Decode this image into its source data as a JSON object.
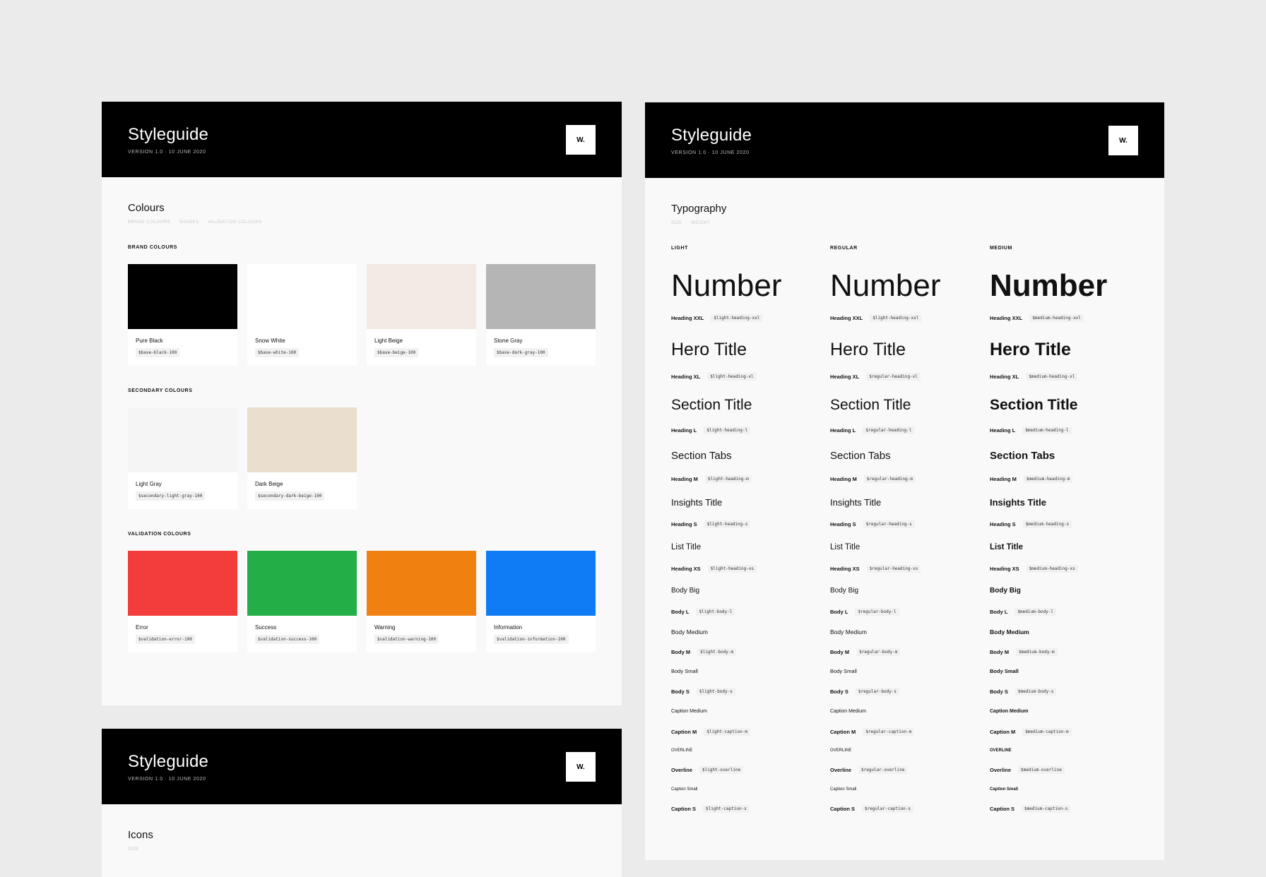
{
  "header": {
    "title": "Styleguide",
    "version": "VERSION 1.0 · 10 JUNE 2020",
    "logo": "W."
  },
  "colours": {
    "title": "Colours",
    "tabs": [
      "BRAND COLOURS",
      "SHADES",
      "VALIDATION COLOURS"
    ],
    "groups": [
      {
        "label": "BRAND COLOURS",
        "swatches": [
          {
            "name": "Pure Black",
            "token": "$base-black-100",
            "color": "#000000"
          },
          {
            "name": "Snow White",
            "token": "$base-white-100",
            "color": "#ffffff"
          },
          {
            "name": "Light Beige",
            "token": "$base-beige-100",
            "color": "#f2ebe3"
          },
          {
            "name": "Stone Gray",
            "token": "$base-dark-gray-100",
            "color": "#b5b5b5"
          }
        ]
      },
      {
        "label": "SECONDARY COLOURS",
        "swatches": [
          {
            "name": "Light Gray",
            "token": "$secondary-light-gray-100",
            "color": "#f5f5f5"
          },
          {
            "name": "Dark Beige",
            "token": "$secondary-dark-beige-100",
            "color": "#eadece"
          }
        ]
      },
      {
        "label": "VALIDATION COLOURS",
        "swatches": [
          {
            "name": "Error",
            "token": "$validation-error-100",
            "color": "#f23d3a"
          },
          {
            "name": "Success",
            "token": "$validation-success-100",
            "color": "#23ae48"
          },
          {
            "name": "Warning",
            "token": "$validation-warning-100",
            "color": "#f0800f"
          },
          {
            "name": "Information",
            "token": "$validation-information-100",
            "color": "#0f7bf5"
          }
        ]
      }
    ]
  },
  "typography": {
    "title": "Typography",
    "tabs": [
      "SIZE",
      "WEIGHT"
    ],
    "columns": [
      {
        "label": "LIGHT",
        "key": "light"
      },
      {
        "label": "REGULAR",
        "key": "regular"
      },
      {
        "label": "MEDIUM",
        "key": "medium"
      }
    ],
    "rows": [
      {
        "sample": "Number",
        "name": "Heading XXL",
        "tokens": [
          "$light-heading-xxl",
          "$light-heading-xxl",
          "$medium-heading-xxl"
        ]
      },
      {
        "sample": "Hero Title",
        "name": "Heading XL",
        "tokens": [
          "$light-heading-xl",
          "$regular-heading-xl",
          "$medium-heading-xl"
        ]
      },
      {
        "sample": "Section Title",
        "name": "Heading L",
        "tokens": [
          "$light-heading-l",
          "$regular-heading-l",
          "$medium-heading-l"
        ]
      },
      {
        "sample": "Section Tabs",
        "name": "Heading M",
        "tokens": [
          "$light-heading-m",
          "$regular-heading-m",
          "$medium-heading-m"
        ]
      },
      {
        "sample": "Insights Title",
        "name": "Heading S",
        "tokens": [
          "$light-heading-s",
          "$regular-heading-s",
          "$medium-heading-s"
        ]
      },
      {
        "sample": "List Title",
        "name": "Heading XS",
        "tokens": [
          "$light-heading-xs",
          "$regular-heading-xs",
          "$medium-heading-xs"
        ]
      },
      {
        "sample": "Body Big",
        "name": "Body L",
        "tokens": [
          "$light-body-l",
          "$regular-body-l",
          "$medium-body-l"
        ]
      },
      {
        "sample": "Body Medium",
        "name": "Body M",
        "tokens": [
          "$light-body-m",
          "$regular-body-m",
          "$medium-body-m"
        ]
      },
      {
        "sample": "Body Small",
        "name": "Body S",
        "tokens": [
          "$light-body-s",
          "$regular-body-s",
          "$medium-body-s"
        ]
      },
      {
        "sample": "Caption Medium",
        "name": "Caption M",
        "tokens": [
          "$light-caption-m",
          "$regular-caption-m",
          "$medium-caption-m"
        ]
      },
      {
        "sample": "OVERLINE",
        "name": "Overline",
        "tokens": [
          "$light-overline",
          "$regular-overline",
          "$medium-overline"
        ]
      },
      {
        "sample": "Caption Small",
        "name": "Caption S",
        "tokens": [
          "$light-caption-s",
          "$regular-caption-s",
          "$medium-caption-s"
        ]
      }
    ]
  },
  "icons": {
    "title": "Icons",
    "tabs": [
      "SIZE"
    ]
  }
}
